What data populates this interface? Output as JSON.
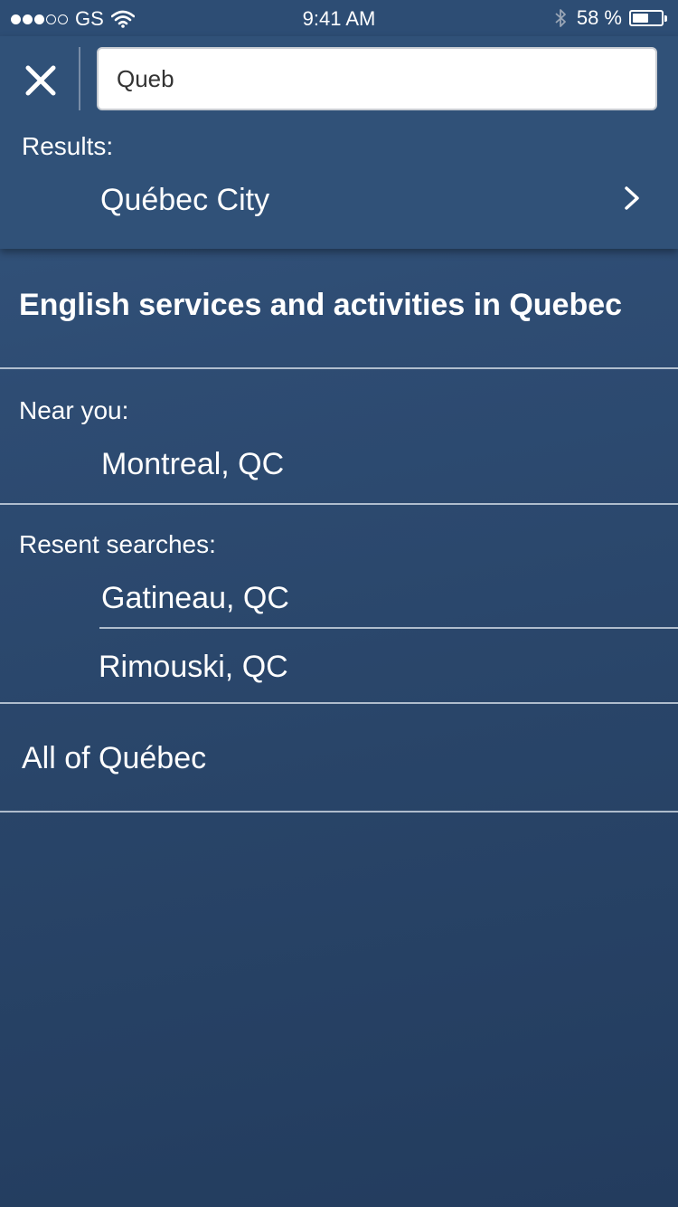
{
  "status_bar": {
    "carrier": "GS",
    "time": "9:41 AM",
    "battery_percent": "58 %",
    "battery_level": 0.58,
    "signal_bars_filled": 3,
    "signal_bars_total": 5
  },
  "search": {
    "value": "Queb",
    "results_label": "Results:",
    "results": [
      "Québec City"
    ]
  },
  "main": {
    "heading": "English services and activities in Quebec",
    "near_you_label": "Near you:",
    "near_you_item": "Montreal, QC",
    "recent_label": "Resent searches:",
    "recent_items": [
      "Gatineau, QC",
      "Rimouski, QC"
    ],
    "all_item": "All of Québec"
  },
  "colors": {
    "background_top": "#35577f",
    "background_bottom": "#233c5e",
    "panel": "#305178",
    "text": "#ffffff"
  }
}
